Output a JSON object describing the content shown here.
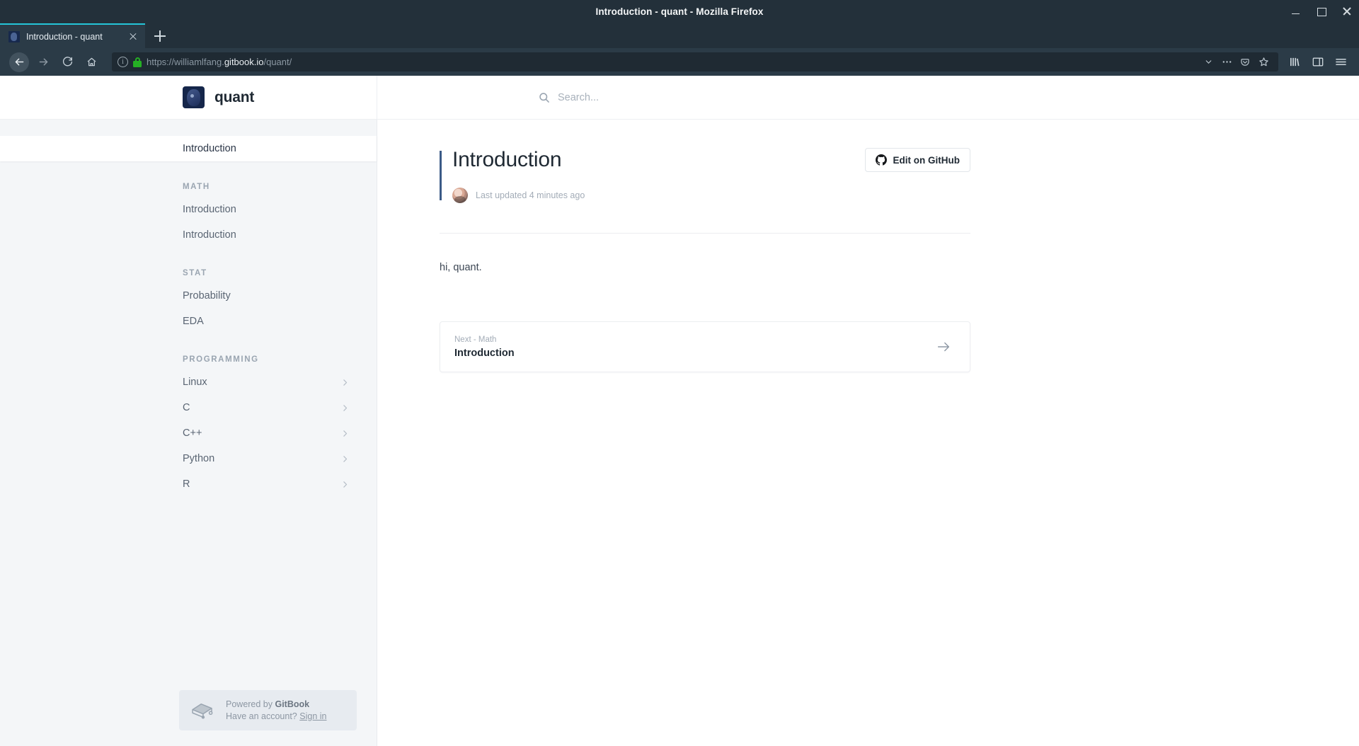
{
  "window": {
    "title": "Introduction - quant - Mozilla Firefox",
    "minimize_label": "Minimize",
    "maximize_label": "Restore",
    "close_label": "Close"
  },
  "browser": {
    "tab": {
      "title": "Introduction - quant",
      "close_label": "Close tab"
    },
    "new_tab_label": "New tab",
    "nav": {
      "back_label": "Back",
      "forward_label": "Forward",
      "reload_label": "Reload",
      "home_label": "Home"
    },
    "url": {
      "prefix": "https://williamlfang.",
      "domain": "gitbook.io",
      "suffix": "/quant/",
      "security": "secure"
    },
    "url_icons": [
      "chevron-down-icon",
      "page-actions-icon",
      "pocket-icon",
      "bookmark-star-icon"
    ],
    "toolbar_icons": [
      "library-icon",
      "sidebar-icon",
      "menu-icon"
    ]
  },
  "site": {
    "logo_alt": "quant logo",
    "title": "quant"
  },
  "search": {
    "placeholder": "Search...",
    "value": ""
  },
  "sidebar": {
    "top_items": [
      {
        "label": "Introduction",
        "active": true,
        "expandable": false
      }
    ],
    "groups": [
      {
        "title": "MATH",
        "items": [
          {
            "label": "Introduction",
            "active": false,
            "expandable": false
          },
          {
            "label": "Introduction",
            "active": false,
            "expandable": false
          }
        ]
      },
      {
        "title": "STAT",
        "items": [
          {
            "label": "Probability",
            "active": false,
            "expandable": false
          },
          {
            "label": "EDA",
            "active": false,
            "expandable": false
          }
        ]
      },
      {
        "title": "PROGRAMMING",
        "items": [
          {
            "label": "Linux",
            "active": false,
            "expandable": true
          },
          {
            "label": "C",
            "active": false,
            "expandable": true
          },
          {
            "label": "C++",
            "active": false,
            "expandable": true
          },
          {
            "label": "Python",
            "active": false,
            "expandable": true
          },
          {
            "label": "R",
            "active": false,
            "expandable": true
          }
        ]
      }
    ],
    "footer": {
      "powered_prefix": "Powered by ",
      "powered_brand": "GitBook",
      "account_prefix": "Have an account? ",
      "signin_label": "Sign in"
    }
  },
  "main": {
    "title": "Introduction",
    "edit_button": "Edit on GitHub",
    "last_updated": "Last updated 4 minutes ago",
    "body": "hi, quant.",
    "next": {
      "label": "Next - Math",
      "title": "Introduction"
    }
  },
  "colors": {
    "chrome_bg": "#2b3b47",
    "titlebar_bg": "#23303a",
    "tab_accent": "#25c5d8",
    "sidebar_bg": "#f4f6f8",
    "accent_bar": "#3b5a87",
    "lock_green": "#25b024"
  }
}
